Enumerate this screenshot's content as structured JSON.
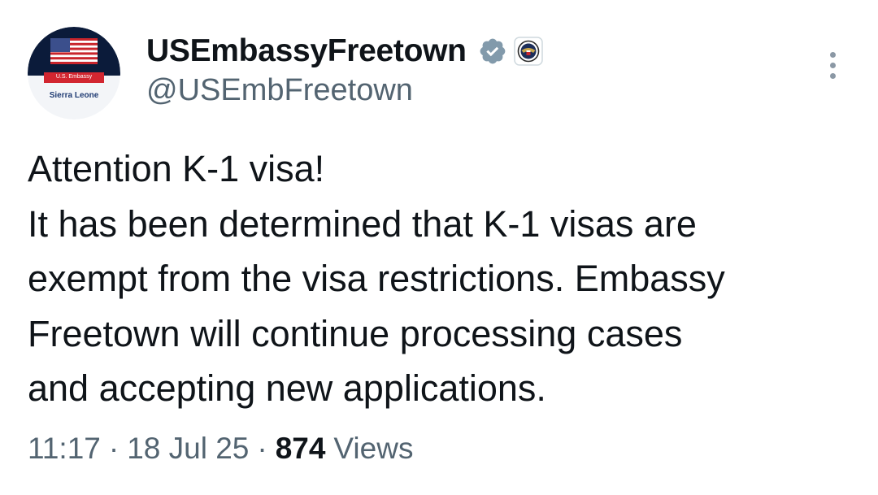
{
  "tweet": {
    "author": {
      "display_name": "USEmbassyFreetown",
      "handle": "@USEmbFreetown",
      "verified_icon": "verified-badge-icon",
      "affiliation_icon": "state-department-seal-icon",
      "avatar": {
        "banner_text": "U.S. Embassy",
        "caption": "Sierra Leone"
      }
    },
    "menu_icon": "more-options-icon",
    "body_lines": [
      "Attention K-1 visa!",
      "It has been determined that K-1 visas are",
      "exempt from the visa restrictions. Embassy",
      "Freetown will continue processing cases",
      "and accepting new applications."
    ],
    "meta": {
      "time": "11:17",
      "separator": "·",
      "date": "18 Jul 25",
      "views_count": "874",
      "views_label": "Views"
    }
  },
  "colors": {
    "text_primary": "#0f1419",
    "text_secondary": "#536471",
    "verified_badge": "#829aab",
    "avatar_red": "#d22630",
    "avatar_navy": "#1f3b73"
  }
}
